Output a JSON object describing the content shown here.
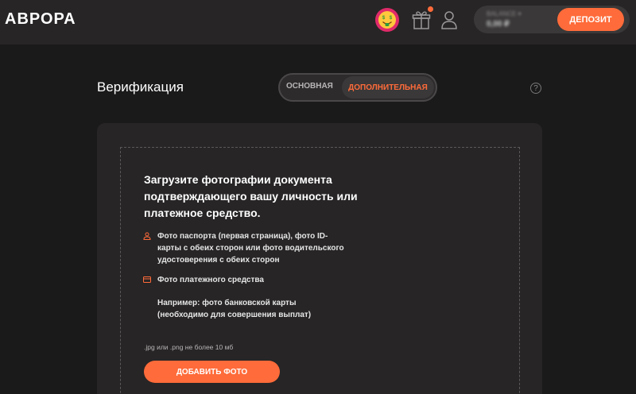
{
  "header": {
    "logo": "АВРОРА",
    "balance_label": "BALANCE ▾",
    "balance_value": "0,00 ₽",
    "deposit_label": "ДЕПОЗИТ"
  },
  "page": {
    "title": "Верификация",
    "tabs": [
      {
        "label": "ОСНОВНАЯ",
        "active": false
      },
      {
        "label": "ДОПОЛНИТЕЛЬНАЯ",
        "active": true
      }
    ],
    "help": "?"
  },
  "upload": {
    "title": "Загрузите фотографии документа подтверждающего вашу личность или платежное средство.",
    "requirements": [
      {
        "icon": "person-icon",
        "text": "Фото паспорта (первая страница), фото ID-карты с обеих сторон или фото водительского удостоверения с обеих сторон"
      },
      {
        "icon": "card-icon",
        "text": "Фото платежного средства"
      }
    ],
    "example": "Например: фото банковской карты (необходимо для совершения выплат)",
    "file_hint": ".jpg или .png не более 10 мб",
    "button_label": "ДОБАВИТЬ ФОТО"
  },
  "colors": {
    "accent": "#ff6b3a",
    "background": "#1b1a1a",
    "header": "#272525",
    "card": "#272525"
  }
}
